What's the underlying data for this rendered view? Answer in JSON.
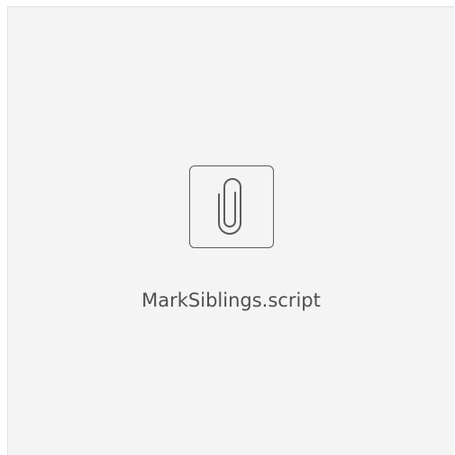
{
  "attachment": {
    "file_name": "MarkSiblings.script",
    "icon": "paperclip-icon"
  },
  "colors": {
    "card_background": "#f4f4f4",
    "icon_stroke": "#5c5c5c",
    "text": "#4f4f4f"
  }
}
